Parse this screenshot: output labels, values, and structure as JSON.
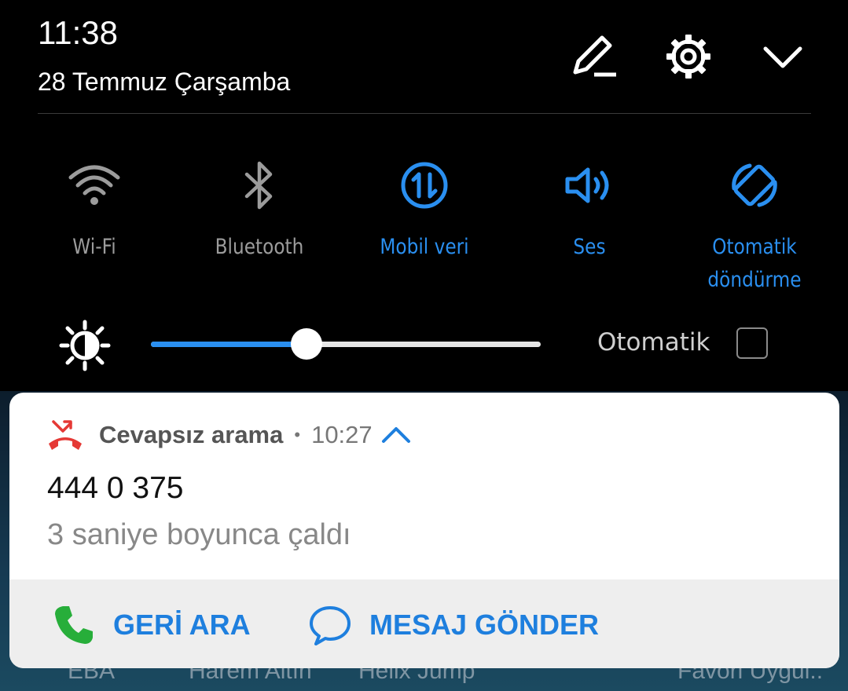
{
  "header": {
    "time": "11:38",
    "date": "28 Temmuz Çarşamba",
    "icons": [
      "edit-icon",
      "settings-icon",
      "collapse-icon"
    ]
  },
  "quick_settings": {
    "tiles": [
      {
        "label": "Wi-Fi",
        "icon": "wifi-icon",
        "state": "off"
      },
      {
        "label": "Bluetooth",
        "icon": "bluetooth-icon",
        "state": "off"
      },
      {
        "label": "Mobil veri",
        "icon": "mobile-data-icon",
        "state": "on"
      },
      {
        "label": "Ses",
        "icon": "sound-icon",
        "state": "on"
      },
      {
        "label_line1": "Otomatik",
        "label_line2": "döndürme",
        "icon": "auto-rotate-icon",
        "state": "on"
      }
    ]
  },
  "brightness": {
    "icon": "brightness-icon",
    "level_fraction": 0.4,
    "auto_label": "Otomatik",
    "auto_checked": false
  },
  "notification": {
    "app_name": "Cevapsız arama",
    "separator": "•",
    "time": "10:27",
    "title": "444 0 375",
    "text": "3 saniye boyunca çaldı",
    "actions": [
      {
        "label": "GERİ ARA",
        "icon": "phone-icon"
      },
      {
        "label": "MESAJ GÖNDER",
        "icon": "message-icon"
      }
    ]
  },
  "background_apps": [
    "EBA",
    "Harem Altın",
    "Helix Jump",
    "Favori Uygul.."
  ],
  "colors": {
    "accent": "#2a8ff0",
    "inactive": "#9c9c9c",
    "missed_call": "#e53935",
    "call_green": "#27ae3a"
  }
}
